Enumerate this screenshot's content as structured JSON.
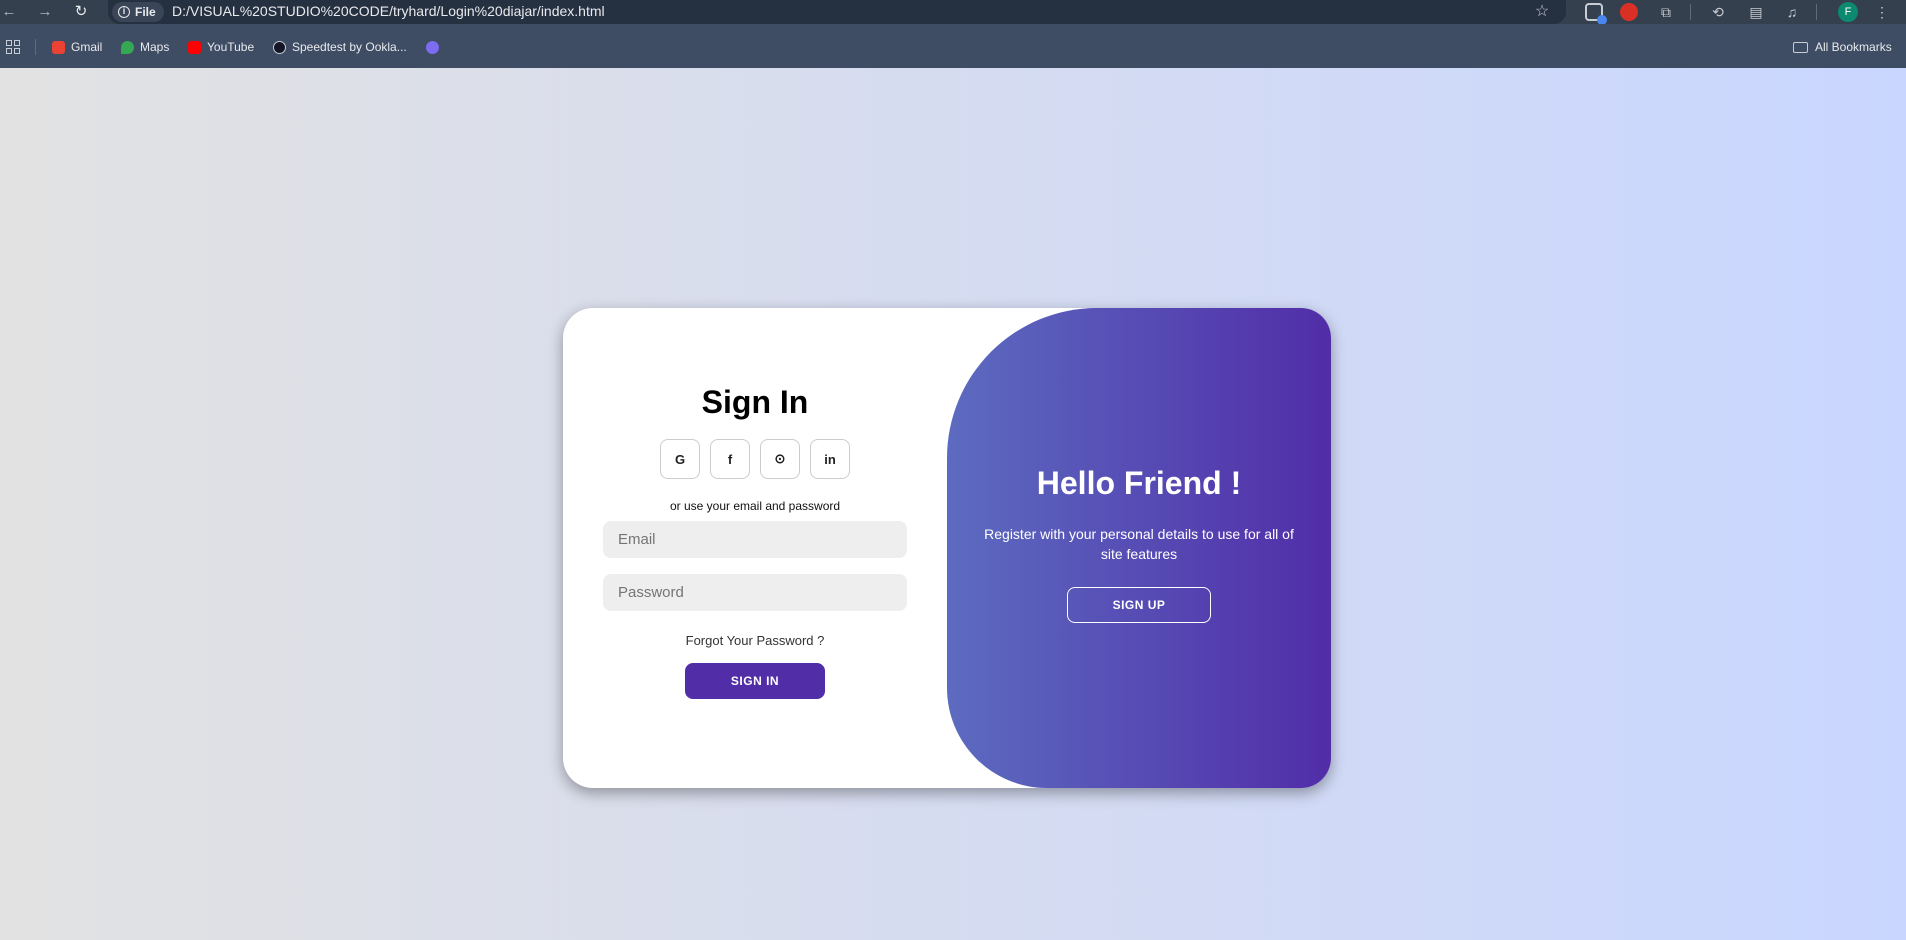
{
  "browser": {
    "file_chip": "File",
    "url": "D:/VISUAL%20STUDIO%20CODE/tryhard/Login%20diajar/index.html",
    "profile_initial": "F",
    "bookmarks": [
      {
        "label": "Gmail",
        "color": "#ea4335"
      },
      {
        "label": "Maps",
        "color": "#34a853"
      },
      {
        "label": "YouTube",
        "color": "#ff0000"
      },
      {
        "label": "Speedtest by Ookla...",
        "color": "#141526"
      }
    ],
    "all_bookmarks": "All Bookmarks"
  },
  "signin": {
    "title": "Sign In",
    "socials": [
      "G",
      "f",
      "⊙",
      "in"
    ],
    "hint": "or use your email and password",
    "email_placeholder": "Email",
    "password_placeholder": "Password",
    "forgot": "Forgot Your Password ?",
    "button": "SIGN IN"
  },
  "toggle": {
    "title": "Hello Friend !",
    "text": "Register with your personal details to use for all of site features",
    "button": "SIGN UP"
  },
  "colors": {
    "primary": "#512da8",
    "gradient_start": "#5c6bc0",
    "page_bg_start": "#e2e2e2",
    "page_bg_end": "#c9d6ff"
  }
}
